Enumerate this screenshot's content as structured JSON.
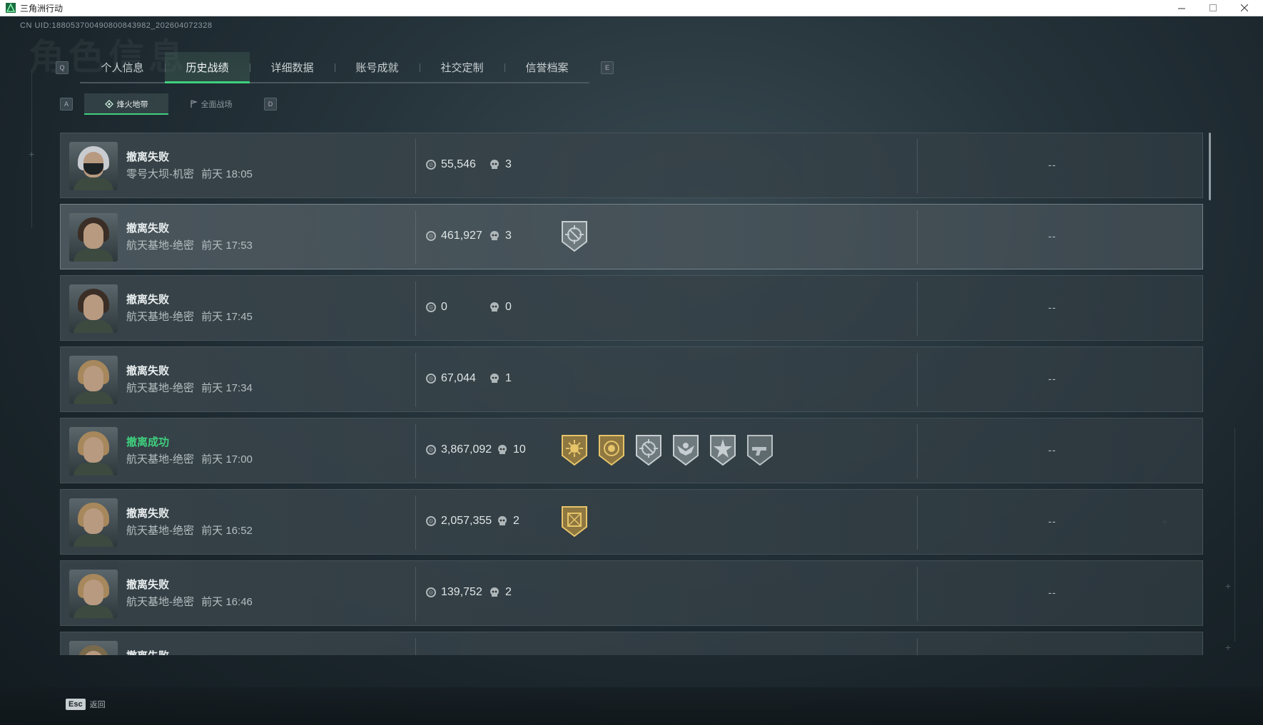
{
  "window": {
    "title": "三角洲行动",
    "controls": [
      "minimize",
      "maximize",
      "close"
    ]
  },
  "uid_text": "CN UID:18805370049080084398​2_202604072328",
  "background_title": "角色信息",
  "tabs": {
    "prev_key": "Q",
    "next_key": "E",
    "items": [
      {
        "label": "个人信息",
        "active": false
      },
      {
        "label": "历史战绩",
        "active": true
      },
      {
        "label": "详细数据",
        "active": false
      },
      {
        "label": "账号成就",
        "active": false
      },
      {
        "label": "社交定制",
        "active": false
      },
      {
        "label": "信誉档案",
        "active": false
      }
    ]
  },
  "subtabs": {
    "prev_key": "A",
    "next_key": "D",
    "items": [
      {
        "label": "烽火地带",
        "icon": "outpost-icon",
        "active": true
      },
      {
        "label": "全面战场",
        "icon": "flag-icon",
        "active": false
      }
    ]
  },
  "records": [
    {
      "status": "撤离失败",
      "success": false,
      "map": "零号大坝-机密",
      "time": "前天 18:05",
      "value": "55,546",
      "kills": "3",
      "avatar": "masked-operator",
      "badges": [],
      "extra": "--"
    },
    {
      "status": "撤离失败",
      "success": false,
      "map": "航天基地-绝密",
      "time": "前天 17:53",
      "value": "461,927",
      "kills": "3",
      "avatar": "female-operator",
      "badges": [
        "crosshair-badge-silver"
      ],
      "extra": "--"
    },
    {
      "status": "撤离失败",
      "success": false,
      "map": "航天基地-绝密",
      "time": "前天 17:45",
      "value": "0",
      "kills": "0",
      "avatar": "female-operator",
      "badges": [],
      "extra": "--"
    },
    {
      "status": "撤离失败",
      "success": false,
      "map": "航天基地-绝密",
      "time": "前天 17:34",
      "value": "67,044",
      "kills": "1",
      "avatar": "male-operator",
      "badges": [],
      "extra": "--"
    },
    {
      "status": "撤离成功",
      "success": true,
      "map": "航天基地-绝密",
      "time": "前天 17:00",
      "value": "3,867,092",
      "kills": "10",
      "avatar": "male-operator",
      "badges": [
        "sunburst-badge-gold",
        "coin-badge-gold",
        "crosshair-badge-silver",
        "eagle-badge-silver",
        "star-badge-silver",
        "gun-badge-silver"
      ],
      "extra": "--"
    },
    {
      "status": "撤离失败",
      "success": false,
      "map": "航天基地-绝密",
      "time": "前天 16:52",
      "value": "2,057,355",
      "kills": "2",
      "avatar": "male-operator",
      "badges": [
        "crate-badge-gold"
      ],
      "extra": "--"
    },
    {
      "status": "撤离失败",
      "success": false,
      "map": "航天基地-绝密",
      "time": "前天 16:46",
      "value": "139,752",
      "kills": "2",
      "avatar": "male-operator",
      "badges": [],
      "extra": "--"
    },
    {
      "status": "撤离失败",
      "success": false,
      "map": "",
      "time": "",
      "value": "",
      "kills": "",
      "avatar": "spiky-operator",
      "badges": [],
      "extra": ""
    }
  ],
  "footer": {
    "key": "Esc",
    "label": "返回"
  },
  "colors": {
    "accent": "#3fd07e",
    "text": "#dfe5e6",
    "panel": "#3c484e"
  }
}
